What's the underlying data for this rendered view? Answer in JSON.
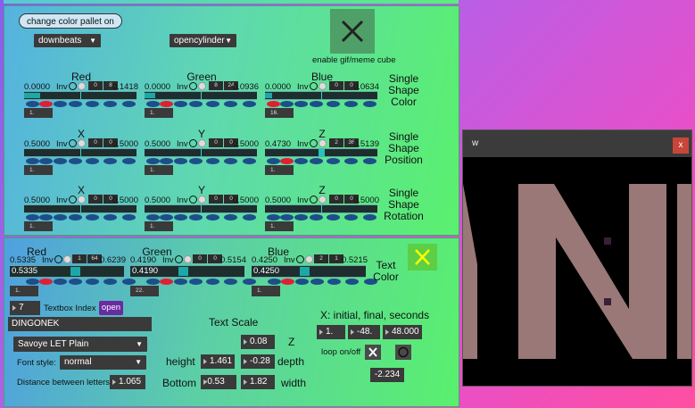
{
  "palette": {
    "bubble_label": "change color pallet on",
    "beat_menu_value": "downbeats",
    "shape_menu_value": "opencylinder",
    "enable_gif_label": "enable gif/meme cube"
  },
  "shape_color": {
    "title": "Single\nShape\nColor",
    "groups": [
      {
        "name": "Red",
        "left": "0.0000",
        "inv": "Inv",
        "n1": "0",
        "n2": "8",
        "right": "0.1418",
        "fill": 0.1418,
        "box": "1."
      },
      {
        "name": "Green",
        "left": "0.0000",
        "inv": "Inv",
        "n1": "8",
        "n2": "24",
        "right": "0.0936",
        "fill": 0.0936,
        "box": "1."
      },
      {
        "name": "Blue",
        "left": "0.0000",
        "inv": "Inv",
        "n1": "0",
        "n2": "0",
        "right": "0.0634",
        "fill": 0.0634,
        "box": "16."
      }
    ]
  },
  "shape_position": {
    "title": "Single\nShape\nPosition",
    "groups": [
      {
        "name": "X",
        "left": "0.5000",
        "inv": "Inv",
        "n1": "0",
        "n2": "0",
        "right": "0.5000",
        "box": "1."
      },
      {
        "name": "Y",
        "left": "0.5000",
        "inv": "Inv",
        "n1": "0",
        "n2": "0",
        "right": "0.5000",
        "box": "1."
      },
      {
        "name": "Z",
        "left": "0.4730",
        "inv": "Inv",
        "n1": "2",
        "n2": "36",
        "right": "0.5139",
        "box": "1."
      }
    ]
  },
  "shape_rotation": {
    "title": "Single\nShape\nRotation",
    "groups": [
      {
        "name": "X",
        "left": "0.5000",
        "inv": "Inv",
        "n1": "0",
        "n2": "0",
        "right": "0.5000",
        "box": "1."
      },
      {
        "name": "Y",
        "left": "0.5000",
        "inv": "Inv",
        "n1": "0",
        "n2": "0",
        "right": "0.5000",
        "box": "1."
      },
      {
        "name": "Z",
        "left": "0.5000",
        "inv": "Inv",
        "n1": "0",
        "n2": "0",
        "right": "0.5000",
        "box": "1."
      }
    ]
  },
  "text_color": {
    "title": "Text\nColor",
    "groups": [
      {
        "name": "Red",
        "left": "0.5335",
        "inv": "Inv",
        "n1": "1",
        "n2": "64",
        "right": "0.6239",
        "value": "0.5335",
        "level": 0.5335,
        "box": "1."
      },
      {
        "name": "Green",
        "left": "0.4190",
        "inv": "Inv",
        "n1": "0",
        "n2": "0",
        "right": "0.5154",
        "value": "0.4190",
        "level": 0.419,
        "box": "22."
      },
      {
        "name": "Blue",
        "left": "0.4250",
        "inv": "Inv",
        "n1": "2",
        "n2": "1",
        "right": "0.5215",
        "value": "0.4250",
        "level": 0.425,
        "box": "1."
      }
    ]
  },
  "textbox": {
    "index_value": "7",
    "index_label": "Textbox Index",
    "open_label": "open",
    "text_value": "DINGONEK",
    "font_menu": "Savoye LET Plain",
    "font_style_label": "Font style:",
    "font_style_value": "normal",
    "letter_spacing_label": "Distance between letters:",
    "letter_spacing_value": "1.065"
  },
  "scale": {
    "title": "Text Scale",
    "z_value": "0.08",
    "z_label": "Z",
    "height_label": "height",
    "height_value": "1.461",
    "depth_value": "-0.28",
    "depth_label": "depth",
    "bottom_label": "Bottom",
    "bottom_value": "-0.53",
    "width_value": "1.82",
    "width_label": "width"
  },
  "motion": {
    "title": "X:  initial, final, seconds",
    "initial": "1.",
    "final": "-48.",
    "seconds": "48.000",
    "loop_label": "loop on/off",
    "readout": "-2.234"
  },
  "window": {
    "title": "w",
    "close": "x",
    "text_color": "#9a7878"
  },
  "colors": {
    "accent_green": "#5af06e",
    "slider_red": "#e01f35",
    "slider_oval": "#1d4e8a",
    "teal": "#1ca8a8"
  }
}
